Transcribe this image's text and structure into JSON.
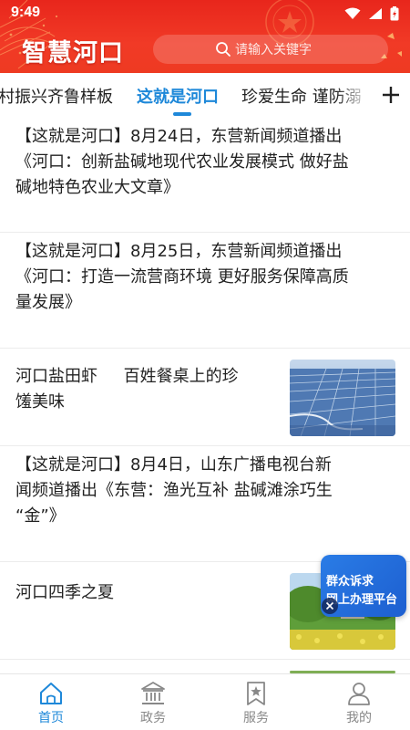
{
  "status_bar": {
    "time": "9:49"
  },
  "header": {
    "title": "智慧河口",
    "search_placeholder": "请输入关键字"
  },
  "tabs": {
    "items": [
      {
        "label": "村振兴齐鲁样板",
        "active": false
      },
      {
        "label": "这就是河口",
        "active": true
      },
      {
        "label": "珍爱生命 谨防溺",
        "active": false
      }
    ],
    "add_icon": "plus-icon"
  },
  "news": [
    {
      "lines": [
        "【这就是河口】8月24日，东营新闻频道播出",
        "《河口：创新盐碱地现代农业发展模式  做好盐",
        "碱地特色农业大文章》"
      ],
      "has_thumb": false
    },
    {
      "lines": [
        "【这就是河口】8月25日，东营新闻频道播出",
        "《河口：打造一流营商环境  更好服务保障高质",
        "量发展》"
      ],
      "has_thumb": false
    },
    {
      "lines": [
        "河口盐田虾     百姓餐桌上的珍",
        "馐美味"
      ],
      "has_thumb": true,
      "thumb": "salt-field-shrimp-ponds-image"
    },
    {
      "lines": [
        "【这就是河口】8月4日，山东广播电视台新",
        "闻频道播出《东营：渔光互补  盐碱滩涂巧生",
        "“金”》"
      ],
      "has_thumb": false
    },
    {
      "lines": [
        "河口四季之夏"
      ],
      "has_thumb": true,
      "thumb": "summer-park-scenery-image"
    }
  ],
  "float_ad": {
    "line1": "群众诉求",
    "line2": "网上办理平台"
  },
  "bottom_nav": [
    {
      "label": "首页",
      "icon": "home-icon",
      "active": true
    },
    {
      "label": "政务",
      "icon": "government-building-icon",
      "active": false
    },
    {
      "label": "服务",
      "icon": "bookmark-star-icon",
      "active": false
    },
    {
      "label": "我的",
      "icon": "user-icon",
      "active": false
    }
  ],
  "colors": {
    "header_red": "#ee3a22",
    "accent_blue": "#1e88d9",
    "ad_blue": "#2a7ce6"
  }
}
